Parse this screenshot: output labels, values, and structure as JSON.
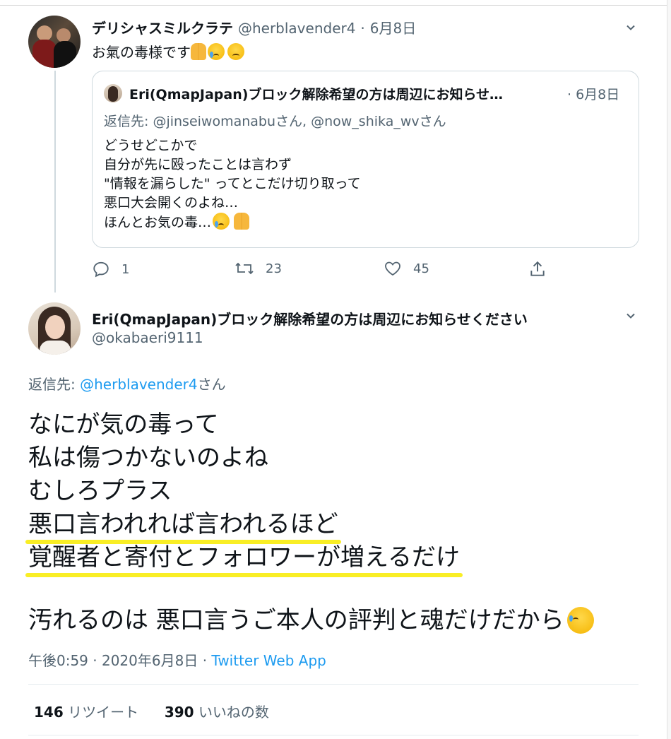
{
  "tweet1": {
    "display_name": "デリシャスミルクラテ",
    "handle": "@herblavender4",
    "separator": "·",
    "date": "6月8日",
    "text": "お氣の毒様です"
  },
  "quoted": {
    "display_name": "Eri(QmapJapan)ブロック解除希望の方は周辺にお知らせ…",
    "date": "· 6月8日",
    "reply_prefix": "返信先: ",
    "reply_targets": "@jinseiwomanabuさん, @now_shika_wvさん",
    "lines": [
      "どうせどこかで",
      "自分が先に殴ったことは言わず",
      "\"情報を漏らした\" ってとこだけ切り取って",
      "悪口大会開くのよね…",
      "ほんとお気の毒…"
    ]
  },
  "actions": {
    "reply_count": "1",
    "retweet_count": "23",
    "like_count": "45"
  },
  "tweet2": {
    "display_name": "Eri(QmapJapan)ブロック解除希望の方は周辺にお知らせください",
    "handle": "@okabaeri9111",
    "reply_prefix": "返信先: ",
    "reply_target": "@herblavender4",
    "reply_suffix": "さん",
    "lines": [
      "なにが気の毒って",
      "私は傷つかないのよね",
      "むしろプラス",
      "悪口言われれば言われるほど",
      "覚醒者と寄付とフォロワーが増えるだけ",
      "",
      "汚れるのは 悪口言うご本人の評判と魂だけだから"
    ],
    "highlight_color": "#f9ee25",
    "time": "午後0:59 · 2020年6月8日 ·",
    "via": "Twitter Web App",
    "retweets_count": "146",
    "retweets_label": "リツイート",
    "likes_count": "390",
    "likes_label": "いいねの数"
  },
  "icons": {
    "more": "chevron-down-icon",
    "reply": "reply-icon",
    "retweet": "retweet-icon",
    "like": "heart-icon",
    "share": "share-icon"
  },
  "colors": {
    "link": "#1d9bf0",
    "muted": "#536471",
    "text": "#0f1419"
  }
}
